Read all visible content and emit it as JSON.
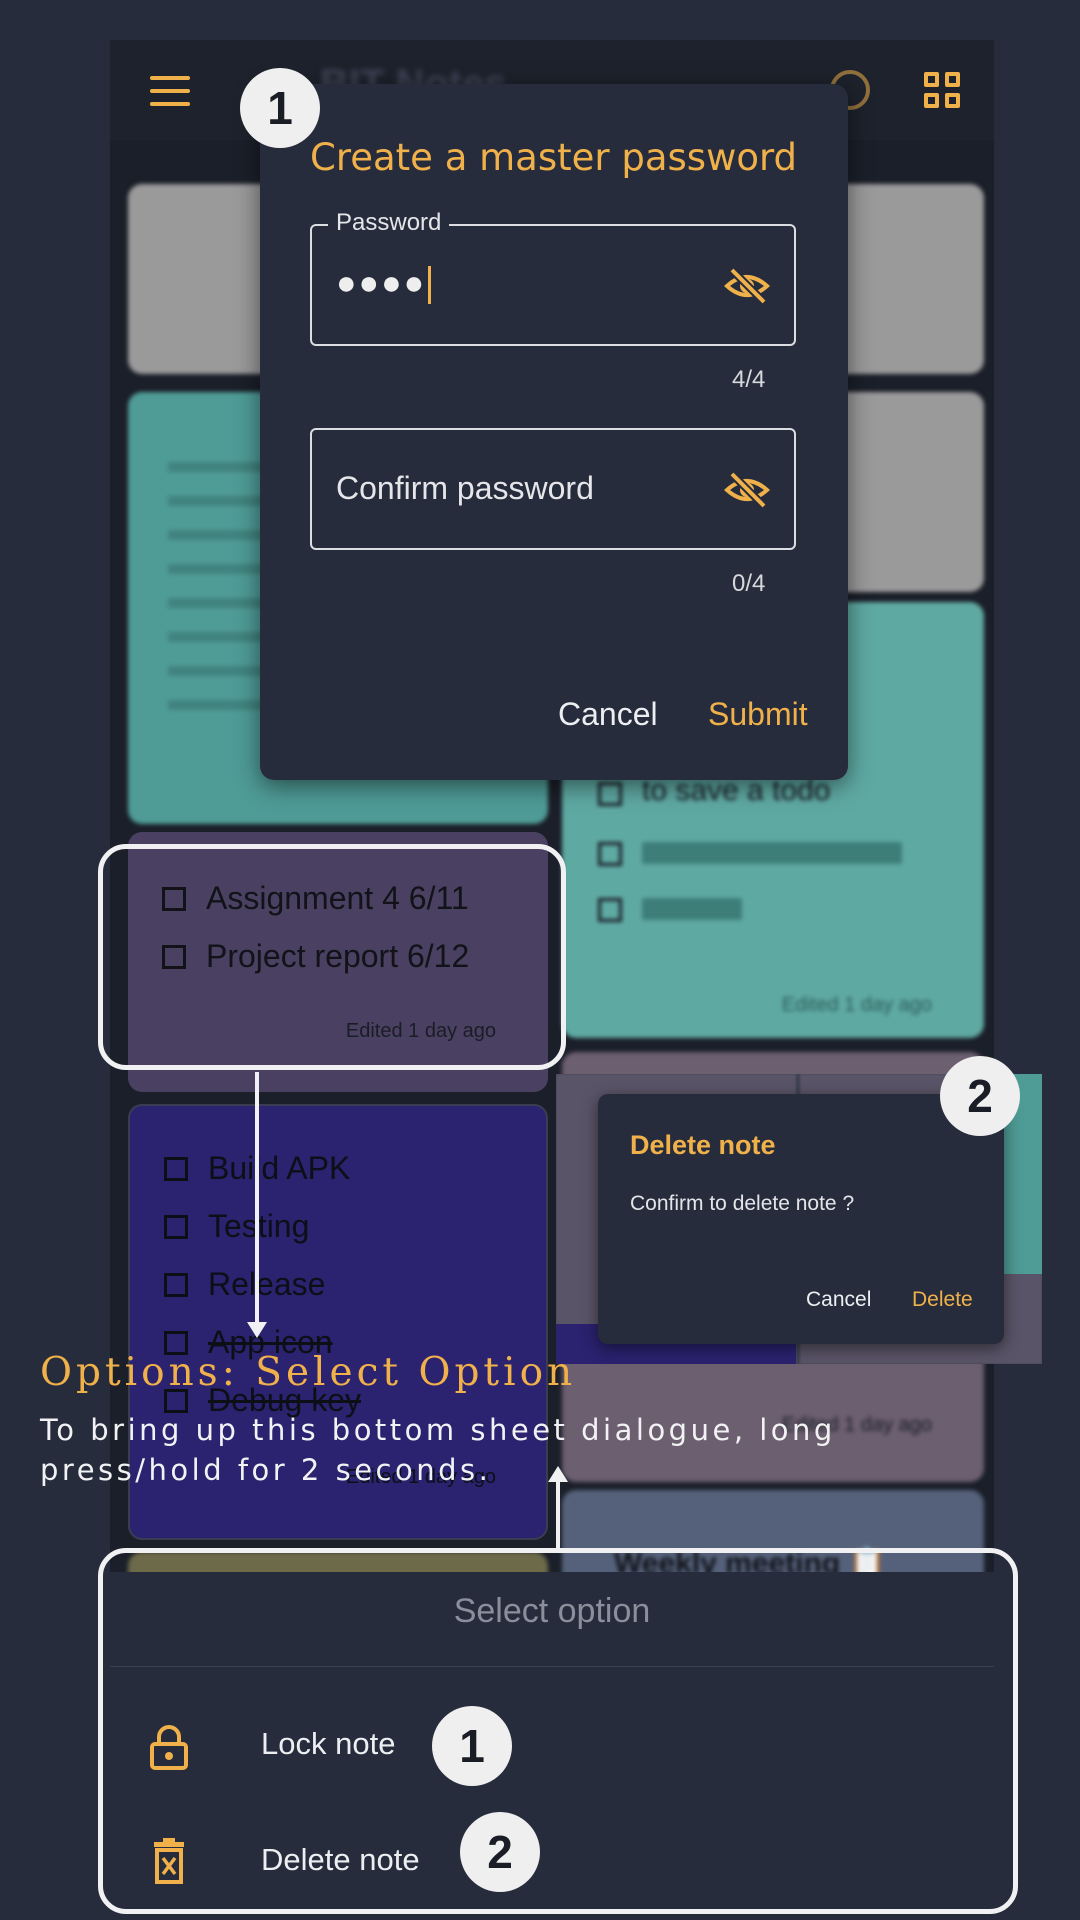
{
  "app": {
    "title": "BIT Notes"
  },
  "background_notes": {
    "focused": {
      "todos": [
        {
          "label": "Assignment 4 6/11",
          "checked": false
        },
        {
          "label": "Project report 6/12",
          "checked": false
        }
      ],
      "edited": "Edited 1 day ago"
    },
    "release": {
      "todos": [
        {
          "label": "Build APK",
          "checked": false
        },
        {
          "label": "Testing",
          "checked": false
        },
        {
          "label": "Release",
          "checked": false
        },
        {
          "label": "App icon",
          "checked": true
        },
        {
          "label": "Debug key",
          "checked": true
        }
      ],
      "edited": "Edited 1 day ago"
    },
    "teal_note": {
      "lines": [
        "to save a todo"
      ],
      "edited": "Edited 1 day ago"
    },
    "pink_note": {
      "edited": "Edited 1 day ago"
    },
    "meeting_note": {
      "title": "Weekly meeting 📋"
    }
  },
  "password_dialog": {
    "title": "Create a master password",
    "password_label": "Password",
    "password_value": "●●●●",
    "password_counter": "4/4",
    "confirm_placeholder": "Confirm password",
    "confirm_counter": "0/4",
    "cancel": "Cancel",
    "submit": "Submit"
  },
  "delete_dialog": {
    "title": "Delete note",
    "message": "Confirm to delete note ?",
    "cancel": "Cancel",
    "delete": "Delete"
  },
  "bottom_sheet": {
    "title": "Select option",
    "options": [
      {
        "label": "Lock note",
        "icon": "lock-icon"
      },
      {
        "label": "Delete note",
        "icon": "trash-icon"
      }
    ]
  },
  "annotation": {
    "title": "Options: Select Option",
    "description": "To bring up this bottom sheet dialogue, long press/hold for 2 seconds.",
    "badges": [
      "1",
      "2",
      "1",
      "2"
    ]
  },
  "colors": {
    "accent": "#f0b14b",
    "background": "#262c3c",
    "dialog": "#262c3b",
    "purple_note": "#4a4061",
    "indigo_note": "#2b2270",
    "teal_note": "#5fa9a3"
  }
}
